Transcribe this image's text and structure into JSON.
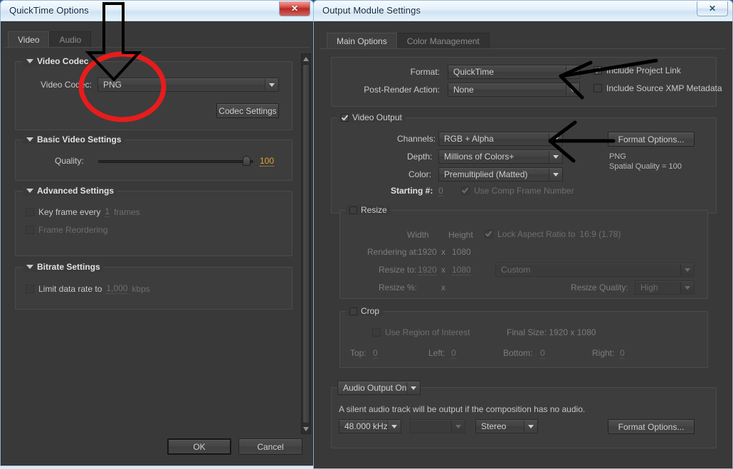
{
  "desktop": {
    "background_hint": "aero-blue-blur"
  },
  "quicktime_dialog": {
    "title": "QuickTime Options",
    "close_label": "✕",
    "tabs": [
      {
        "label": "Video",
        "active": true
      },
      {
        "label": "Audio",
        "active": false
      }
    ],
    "video_codec_group": {
      "legend": "Video Codec",
      "codec_label": "Video Codec:",
      "codec_value": "PNG",
      "codec_settings_button": "Codec Settings"
    },
    "basic_video_group": {
      "legend": "Basic Video Settings",
      "quality_label": "Quality:",
      "quality_value": "100"
    },
    "advanced_group": {
      "legend": "Advanced Settings",
      "key_frame_label": "Key frame every",
      "key_frame_value": "1",
      "key_frame_unit": "frames",
      "frame_reordering_label": "Frame Reordering"
    },
    "bitrate_group": {
      "legend": "Bitrate Settings",
      "limit_label": "Limit data rate to",
      "limit_value": "1,000",
      "limit_unit": "kbps"
    },
    "ok_button": "OK",
    "cancel_button": "Cancel"
  },
  "output_module_dialog": {
    "title": "Output Module Settings",
    "close_label": "✕",
    "tabs": [
      {
        "label": "Main Options",
        "active": true
      },
      {
        "label": "Color Management",
        "active": false
      }
    ],
    "format_group": {
      "format_label": "Format:",
      "format_value": "QuickTime",
      "post_render_label": "Post-Render Action:",
      "post_render_value": "None",
      "include_project_link": "Include Project Link",
      "include_xmp": "Include Source XMP Metadata"
    },
    "video_output_group": {
      "legend": "Video Output",
      "channels_label": "Channels:",
      "channels_value": "RGB + Alpha",
      "depth_label": "Depth:",
      "depth_value": "Millions of Colors+",
      "color_label": "Color:",
      "color_value": "Premultiplied (Matted)",
      "starting_label": "Starting #:",
      "starting_value": "0",
      "use_comp_frame_number": "Use Comp Frame Number",
      "format_options_button": "Format Options...",
      "info_line1": "PNG",
      "info_line2": "Spatial Quality = 100"
    },
    "resize_group": {
      "legend": "Resize",
      "width_header": "Width",
      "height_header": "Height",
      "lock_aspect_label": "Lock Aspect Ratio to",
      "lock_aspect_value": "16:9 (1.78)",
      "rendering_at_label": "Rendering at:",
      "rendering_width": "1920",
      "rendering_x": "x",
      "rendering_height": "1080",
      "resize_to_label": "Resize to:",
      "resize_width": "1920",
      "resize_x": "x",
      "resize_height": "1080",
      "preset_value": "Custom",
      "resize_pct_label": "Resize %:",
      "resize_pct_x": "x",
      "resize_quality_label": "Resize Quality:",
      "resize_quality_value": "High"
    },
    "crop_group": {
      "legend": "Crop",
      "use_region_label": "Use Region of Interest",
      "final_size_label": "Final Size: 1920 x 1080",
      "top_label": "Top:",
      "top_value": "0",
      "left_label": "Left:",
      "left_value": "0",
      "bottom_label": "Bottom:",
      "bottom_value": "0",
      "right_label": "Right:",
      "right_value": "0"
    },
    "audio_group": {
      "toggle_value": "Audio Output On",
      "note": "A silent audio track will be output if the composition has no audio.",
      "rate_value": "48.000 kHz",
      "bitdepth_value": "",
      "channels_value": "Stereo",
      "format_options_button": "Format Options..."
    }
  },
  "annotations": {
    "ellipse_color": "#e81c1c",
    "arrow_color": "#000000",
    "arrow_down_target": "video-codec-png-dropdown",
    "arrow_left_1_target": "format-dropdown",
    "arrow_left_2_target": "channels-dropdown"
  }
}
